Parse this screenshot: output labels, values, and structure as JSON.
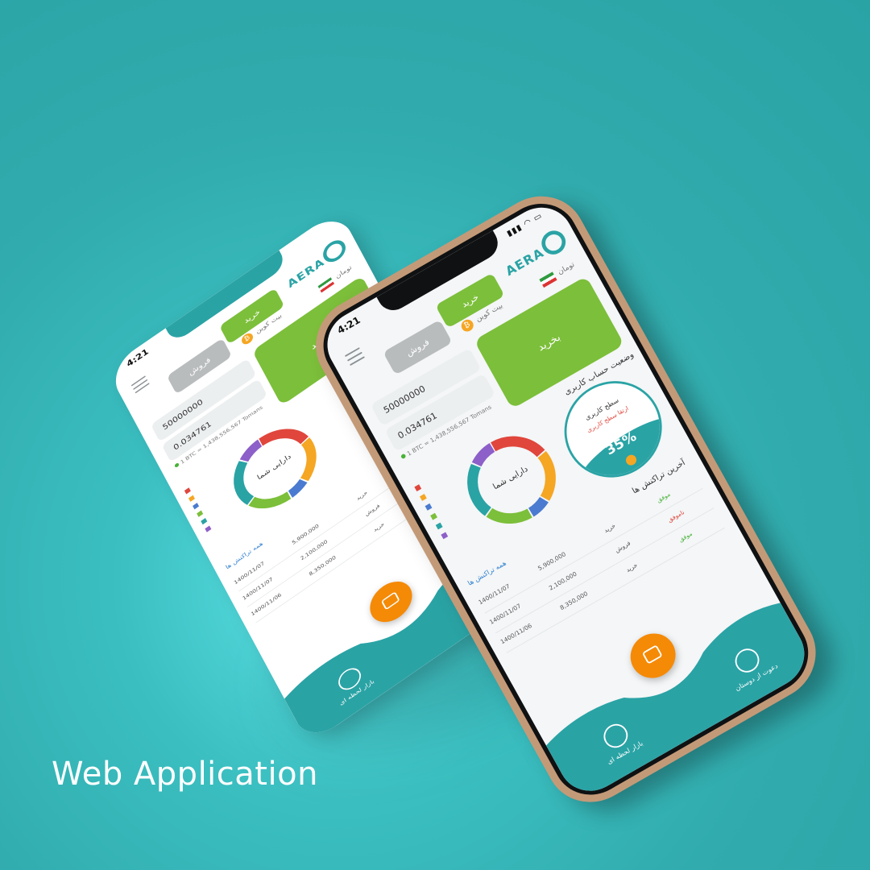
{
  "caption": "Web Application",
  "app": {
    "status_time": "4:21",
    "status_icons": "▮▮▮ ◠ ▭",
    "logo_text": "AERA",
    "currency_label": "بیت کوین",
    "fiat_label": "تومان",
    "tabs": {
      "buy": "خرید",
      "sell": "فروش"
    },
    "amount_value": "50000000",
    "crypto_value": "0.034761",
    "rate_note": "1 BTC = 1,438,556,567 Tomans",
    "buy_button": "بخرید",
    "account_status_title": "وضعیت حساب کاربری",
    "level_label": "سطح کاربری",
    "level_note": "ارتقا سطح کاربری",
    "account_percent": "35%",
    "portfolio_title": "دارایی شما",
    "history_title": "آخرین تراکنش ها",
    "history_link": "همه تراکنش ها",
    "transactions": [
      {
        "date": "1400/11/07",
        "amount": "5,900,000",
        "type": "خرید",
        "status": "موفق"
      },
      {
        "date": "1400/11/07",
        "amount": "2,100,000",
        "type": "فروش",
        "status": "ناموفق"
      },
      {
        "date": "1400/11/06",
        "amount": "8,350,000",
        "type": "خرید",
        "status": "موفق"
      }
    ],
    "nav": {
      "left": "بازار لحظه ای",
      "right": "دعوت از دوستان"
    }
  },
  "portfolio_chart": {
    "type": "donut",
    "segments": [
      {
        "color": "#e0463c",
        "value": 22
      },
      {
        "color": "#f5a623",
        "value": 20
      },
      {
        "color": "#4a7bd0",
        "value": 8
      },
      {
        "color": "#7cbf3a",
        "value": 18
      },
      {
        "color": "#2aa3a5",
        "value": 22
      },
      {
        "color": "#8d5fc9",
        "value": 10
      }
    ]
  },
  "colors": {
    "background": "#31abad",
    "brand_teal": "#2aa3a5",
    "buy_green": "#7cbf3a",
    "sell_gray": "#b9bcbd",
    "fab_orange": "#f58a07",
    "phone_frame": "#c39a78"
  }
}
